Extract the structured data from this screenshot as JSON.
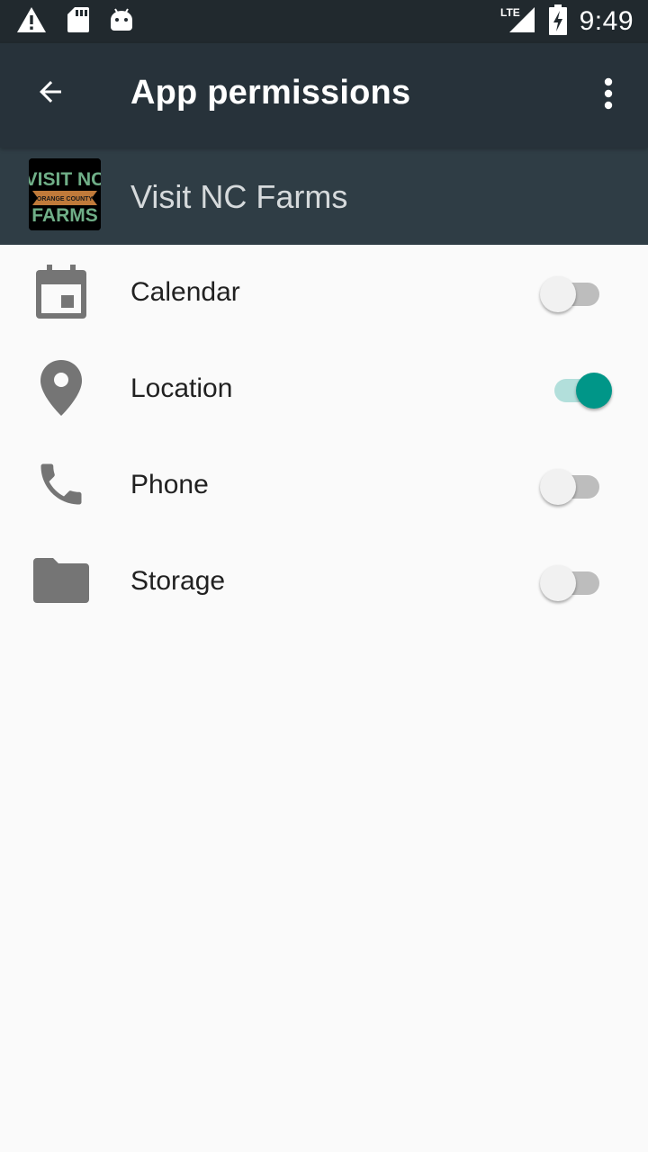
{
  "status_bar": {
    "time": "9:49",
    "network": "LTE",
    "icons": [
      "warning-icon",
      "sd-card-icon",
      "android-icon",
      "signal-icon",
      "battery-charging-icon"
    ]
  },
  "toolbar": {
    "title": "App permissions",
    "back_icon": "arrow-back-icon",
    "menu_icon": "more-vert-icon"
  },
  "app": {
    "name": "Visit NC Farms",
    "logo_text": [
      "VISIT NC",
      "ORANGE COUNTY",
      "FARMS"
    ]
  },
  "permissions": [
    {
      "label": "Calendar",
      "icon": "calendar-icon",
      "enabled": false
    },
    {
      "label": "Location",
      "icon": "location-pin-icon",
      "enabled": true
    },
    {
      "label": "Phone",
      "icon": "phone-icon",
      "enabled": false
    },
    {
      "label": "Storage",
      "icon": "folder-icon",
      "enabled": false
    }
  ],
  "colors": {
    "status_bar": "#21292e",
    "app_bar": "#27323a",
    "app_header": "#2f3d45",
    "accent": "#009688",
    "icon_grey": "#757575"
  }
}
